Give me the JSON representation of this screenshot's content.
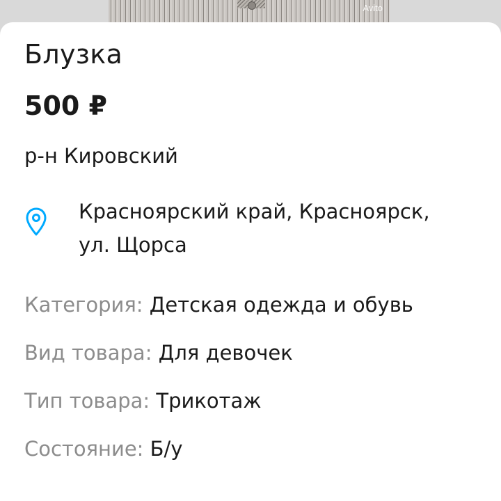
{
  "photo": {
    "watermark": "Avito"
  },
  "listing": {
    "title": "Блузка",
    "price": "500 ₽",
    "district": "р-н Кировский",
    "address_line1": "Красноярский край, Красноярск,",
    "address_line2": "ул. Щорса"
  },
  "params": [
    {
      "label": "Категория:",
      "value": "Детская одежда и обувь"
    },
    {
      "label": "Вид товара:",
      "value": "Для девочек"
    },
    {
      "label": "Тип товара:",
      "value": "Трикотаж"
    },
    {
      "label": "Состояние:",
      "value": "Б/у"
    }
  ],
  "colors": {
    "accent": "#00aaff",
    "label_gray": "#8c8c8c",
    "text": "#1a1a1a"
  },
  "icons": {
    "location": "location-pin-icon"
  }
}
